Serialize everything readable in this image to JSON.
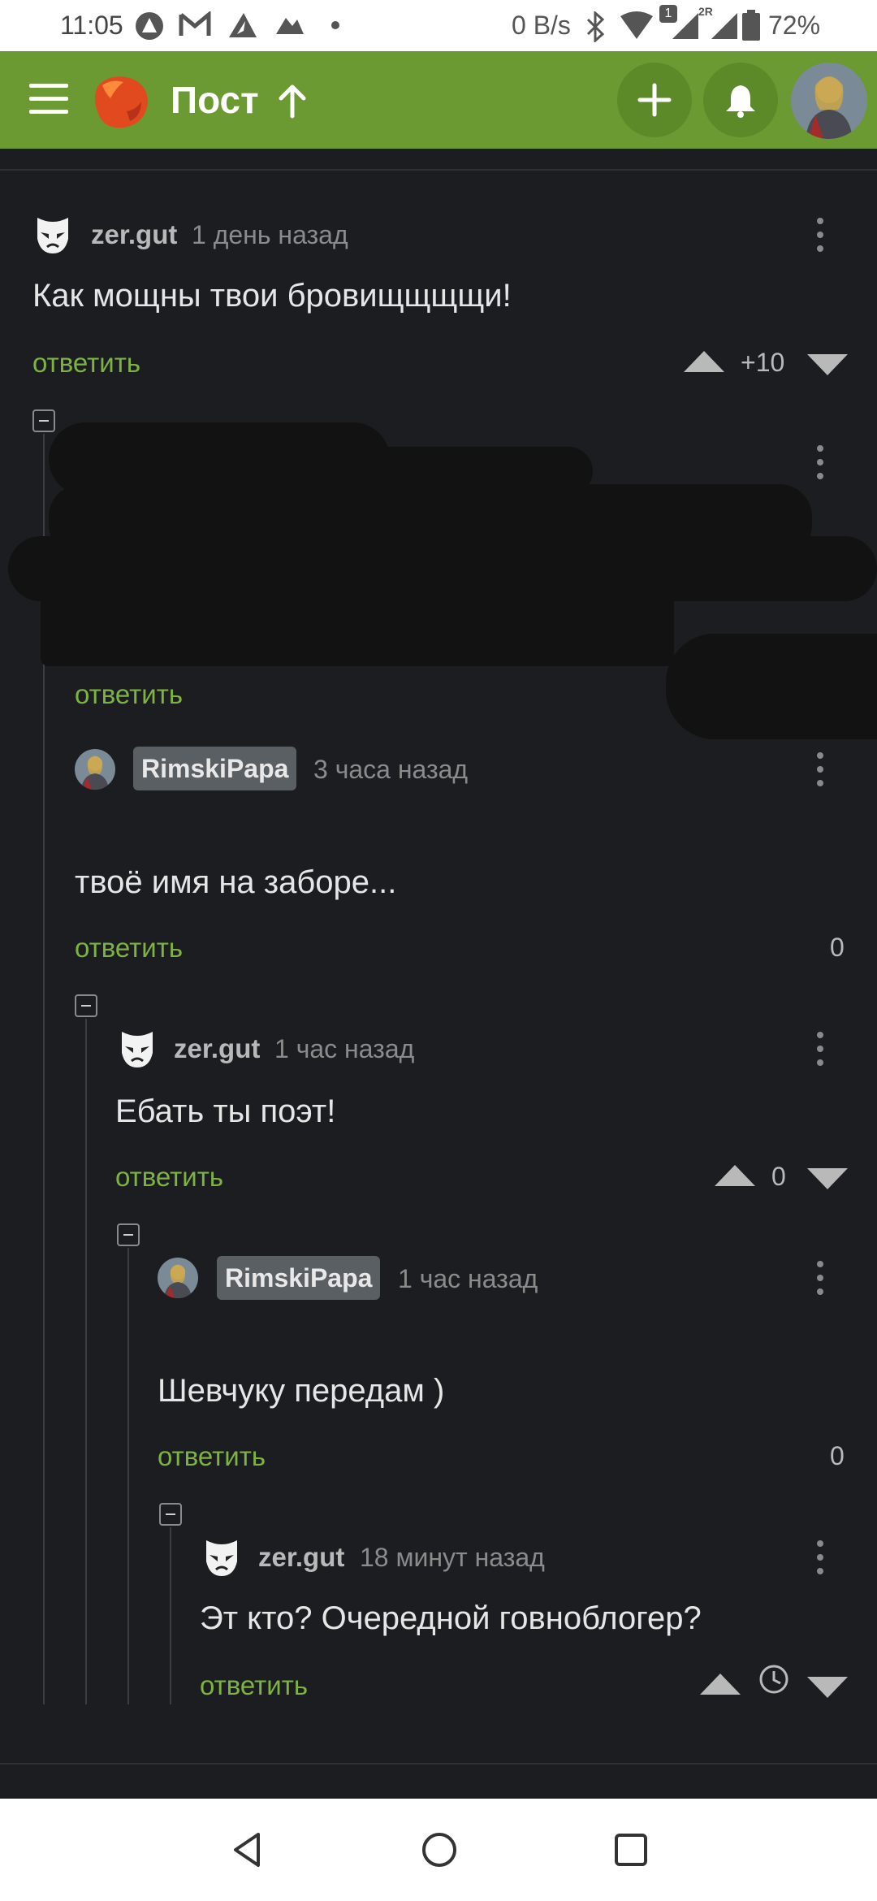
{
  "status_bar": {
    "time": "11:05",
    "net_speed": "0 B/s",
    "sim_badge": "1",
    "sim2_badge": "2R",
    "battery": "72%"
  },
  "header": {
    "title": "Пост",
    "accent_color": "#6b9a32"
  },
  "comments": [
    {
      "author": "zer.gut",
      "time": "1 день назад",
      "text": "Как мощны твои бровищщщщи!",
      "reply_label": "ответить",
      "score": "+10"
    },
    {
      "reply_label": "ответить"
    },
    {
      "author": "RimskiPapa",
      "time": "3 часа назад",
      "text": "твоё имя на заборе...",
      "reply_label": "ответить",
      "score": "0"
    },
    {
      "author": "zer.gut",
      "time": "1 час назад",
      "text": "Ебать ты поэт!",
      "reply_label": "ответить",
      "score": "0"
    },
    {
      "author": "RimskiPapa",
      "time": "1 час назад",
      "text": "Шевчуку передам )",
      "reply_label": "ответить",
      "score": "0"
    },
    {
      "author": "zer.gut",
      "time": "18 минут назад",
      "text": "Эт кто? Очередной говноблогер?",
      "reply_label": "ответить"
    }
  ],
  "icons": {
    "menu": "menu-icon",
    "logo": "app-logo",
    "add": "plus-icon",
    "notifications": "bell-icon",
    "options": "kebab-icon",
    "upvote": "upvote-icon",
    "downvote": "downvote-icon",
    "pending": "clock-icon"
  }
}
